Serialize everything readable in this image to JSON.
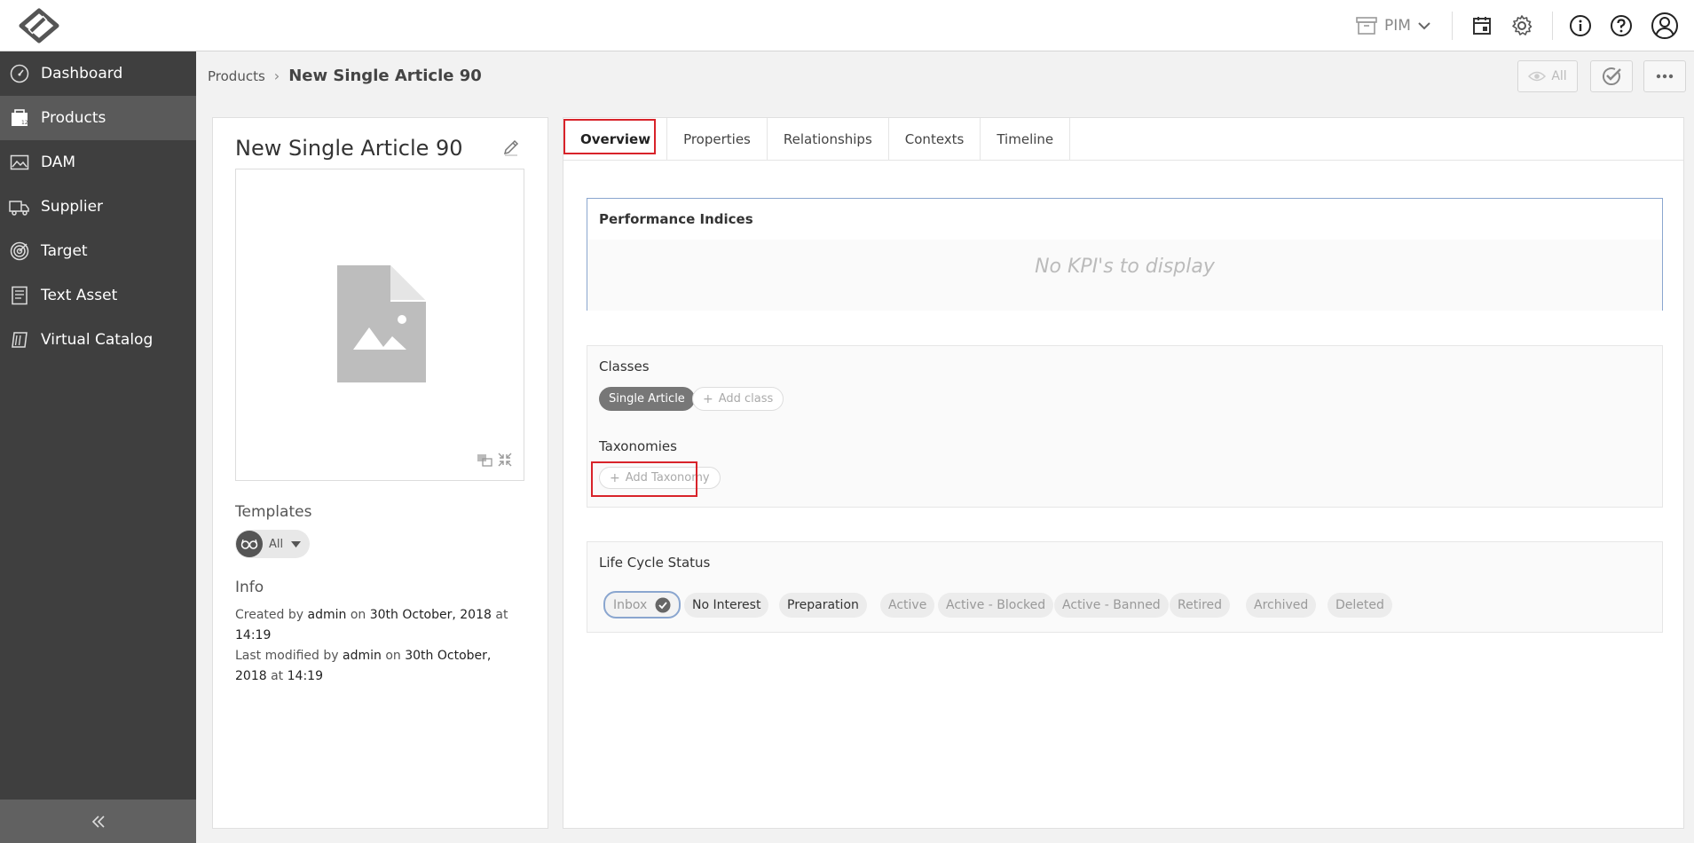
{
  "topbar": {
    "module_select": "PIM",
    "icons": [
      "logo-icon",
      "archive-icon",
      "chevron-down-icon",
      "calendar-box-icon",
      "gear-icon",
      "info-icon",
      "help-icon",
      "user-icon"
    ]
  },
  "sidebar": {
    "items": [
      {
        "label": "Dashboard",
        "icon": "dashboard-icon",
        "active": false
      },
      {
        "label": "Products",
        "icon": "products-icon",
        "active": true
      },
      {
        "label": "DAM",
        "icon": "image-icon",
        "active": false
      },
      {
        "label": "Supplier",
        "icon": "truck-icon",
        "active": false
      },
      {
        "label": "Target",
        "icon": "target-icon",
        "active": false
      },
      {
        "label": "Text Asset",
        "icon": "text-asset-icon",
        "active": false
      },
      {
        "label": "Virtual Catalog",
        "icon": "catalog-icon",
        "active": false
      }
    ]
  },
  "breadcrumb": {
    "root": "Products",
    "separator": "›",
    "current": "New Single Article 90"
  },
  "header_actions": {
    "view_filter": "All"
  },
  "product": {
    "title": "New Single Article 90",
    "templates_label": "Templates",
    "templates_value": "All",
    "info_label": "Info",
    "created_prefix": "Created by",
    "created_by": "admin",
    "created_on_word": "on",
    "created_date": "30th October, 2018",
    "created_at_word": "at",
    "created_time": "14:19",
    "modified_prefix": "Last modified by",
    "modified_by": "admin",
    "modified_on_word": "on",
    "modified_date_part1": "30th October,",
    "modified_date_part2": "2018",
    "modified_at_word": "at",
    "modified_time": "14:19"
  },
  "tabs": [
    {
      "label": "Overview",
      "active": true
    },
    {
      "label": "Properties",
      "active": false
    },
    {
      "label": "Relationships",
      "active": false
    },
    {
      "label": "Contexts",
      "active": false
    },
    {
      "label": "Timeline",
      "active": false
    }
  ],
  "performance": {
    "title": "Performance Indices",
    "empty": "No KPI's to display"
  },
  "classes": {
    "title": "Classes",
    "chips": [
      "Single Article"
    ],
    "add_label": "Add class"
  },
  "taxonomies": {
    "title": "Taxonomies",
    "add_label": "Add Taxonomy"
  },
  "lifecycle": {
    "title": "Life Cycle Status",
    "statuses": [
      {
        "label": "Inbox",
        "state": "selected"
      },
      {
        "label": "No Interest",
        "state": "enabled"
      },
      {
        "label": "Preparation",
        "state": "enabled"
      },
      {
        "label": "Active",
        "state": "disabled"
      },
      {
        "label": "Active - Blocked",
        "state": "disabled"
      },
      {
        "label": "Active - Banned",
        "state": "disabled"
      },
      {
        "label": "Retired",
        "state": "disabled"
      },
      {
        "label": "Archived",
        "state": "disabled"
      },
      {
        "label": "Deleted",
        "state": "disabled"
      }
    ]
  },
  "colors": {
    "sidebar_bg": "#3f3f3f",
    "sidebar_active": "#5a5a5a",
    "highlight_red": "#d8232a",
    "kpi_border": "#8aa6cf"
  }
}
